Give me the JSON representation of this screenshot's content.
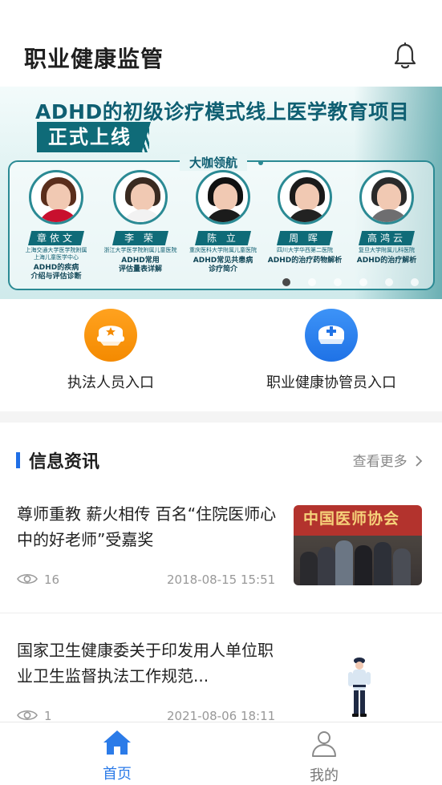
{
  "header": {
    "title": "职业健康监管",
    "bell_icon": "bell-icon"
  },
  "banner": {
    "headline": "ADHD的初级诊疗模式线上医学教育项目",
    "launch": "正式上线",
    "panel_title": "大咖领航",
    "experts": [
      {
        "name": "章依文",
        "affiliation": "上海交通大学医学院附属\n上海儿童医学中心",
        "topic": "ADHD的疾病\n介绍与评估诊断"
      },
      {
        "name": "李 荣",
        "affiliation": "浙江大学医学院附属儿童医院",
        "topic": "ADHD常用\n评估量表详解"
      },
      {
        "name": "陈 立",
        "affiliation": "重庆医科大学附属儿童医院",
        "topic": "ADHD常见共患病\n诊疗简介"
      },
      {
        "name": "周 晖",
        "affiliation": "四川大学华西第二医院",
        "topic": "ADHD的治疗药物解析"
      },
      {
        "name": "高鸿云",
        "affiliation": "复旦大学附属儿科医院",
        "topic": "ADHD的治疗解析"
      }
    ],
    "carousel": {
      "count": 6,
      "active": 1
    }
  },
  "entries": [
    {
      "label": "执法人员入口",
      "icon": "police-cap-icon",
      "color": "#f48a00"
    },
    {
      "label": "职业健康协管员入口",
      "icon": "nurse-cap-icon",
      "color": "#1f72e6"
    }
  ],
  "news": {
    "title": "信息资讯",
    "more": "查看更多",
    "items": [
      {
        "headline": "尊师重教 薪火相传 百名“住院医师心中的好老师”受嘉奖",
        "views": "16",
        "date": "2018-08-15 15:51",
        "thumb_text": "中国医师协会"
      },
      {
        "headline": "国家卫生健康委关于印发用人单位职业卫生监督执法工作规范...",
        "views": "1",
        "date": "2021-08-06 18:11"
      }
    ]
  },
  "tabbar": {
    "tabs": [
      {
        "label": "首页",
        "icon": "home-icon",
        "active": true
      },
      {
        "label": "我的",
        "icon": "user-icon",
        "active": false
      }
    ]
  },
  "colors": {
    "accent": "#2b7be8",
    "teal": "#0f6b78",
    "orange": "#f48a00"
  }
}
